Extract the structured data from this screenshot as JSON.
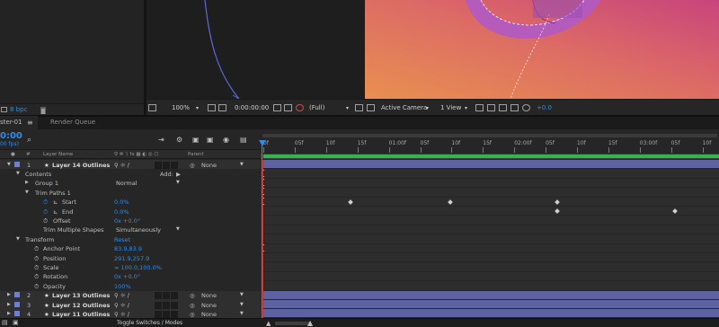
{
  "project": {
    "bpc_label": "8 bpc"
  },
  "comp_controls": {
    "magnification": "100%",
    "timecode": "0:00:00:00",
    "resolution": "(Full)",
    "camera": "Active Camera",
    "view_layout": "1 View",
    "exposure": "+0.0"
  },
  "tabs": [
    {
      "label": "ster-01"
    },
    {
      "label": "Render Queue"
    }
  ],
  "timeline": {
    "time_code": "0:00",
    "fps": "00 fps)",
    "search_label": "⌕"
  },
  "columns": {
    "number": "#",
    "layer_name": "Layer Name",
    "parent": "Parent"
  },
  "ruler_labels": [
    "0f",
    "05f",
    "10f",
    "15f",
    "01:00f",
    "05f",
    "10f",
    "15f",
    "02:00f",
    "05f",
    "10f",
    "15f",
    "03:00f",
    "05f",
    "10f"
  ],
  "layers": {
    "layer1": {
      "number": "1",
      "name": "Layer 14 Outlines",
      "parent": "None"
    },
    "contents": "Contents",
    "add_label": "Add:",
    "group1": {
      "label": "Group 1",
      "value": "Normal"
    },
    "trim_paths": "Trim Paths 1",
    "start": {
      "label": "Start",
      "value": "0.0%"
    },
    "end": {
      "label": "End",
      "value": "0.0%"
    },
    "offset": {
      "label": "Offset",
      "value": "0x +0.0°"
    },
    "trim_multiple": {
      "label": "Trim Multiple Shapes",
      "value": "Simultaneously"
    },
    "transform": {
      "label": "Transform",
      "value": "Reset"
    },
    "anchor_point": {
      "label": "Anchor Point",
      "value": "83.9,83.9"
    },
    "position": {
      "label": "Position",
      "value": "291.9,257.9"
    },
    "scale": {
      "label": "Scale",
      "value": "∞ 100.0,100.0%"
    },
    "rotation": {
      "label": "Rotation",
      "value": "0x +0.0°"
    },
    "opacity": {
      "label": "Opacity",
      "value": "100%"
    },
    "layer2": {
      "number": "2",
      "name": "Layer 13 Outlines",
      "parent": "None"
    },
    "layer3": {
      "number": "3",
      "name": "Layer 12 Outlines",
      "parent": "None"
    },
    "layer4": {
      "number": "4",
      "name": "Layer 11 Outlines",
      "parent": "None"
    }
  },
  "bottom": {
    "toggle_label": "Toggle Switches / Modes"
  },
  "colors": {
    "accent_blue": "#2d8ceb",
    "label_purple": "#6f7ed6",
    "layer_bar": "#5c63a0",
    "work_area": "#37b24d",
    "playhead": "#2d8ceb",
    "gradient_orange": "#e88653",
    "gradient_pink": "#c8447c"
  }
}
